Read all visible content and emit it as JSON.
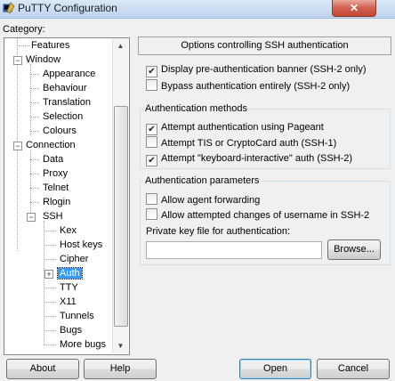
{
  "window": {
    "title": "PuTTY Configuration",
    "close_label": "✕",
    "icon": "putty-app-icon"
  },
  "category_label": "Category:",
  "tree": {
    "items": [
      {
        "label": "Features",
        "level": 2
      },
      {
        "label": "Window",
        "level": 1,
        "expanded": true
      },
      {
        "label": "Appearance",
        "level": 2
      },
      {
        "label": "Behaviour",
        "level": 2
      },
      {
        "label": "Translation",
        "level": 2
      },
      {
        "label": "Selection",
        "level": 2
      },
      {
        "label": "Colours",
        "level": 2
      },
      {
        "label": "Connection",
        "level": 1,
        "expanded": true
      },
      {
        "label": "Data",
        "level": 2
      },
      {
        "label": "Proxy",
        "level": 2
      },
      {
        "label": "Telnet",
        "level": 2
      },
      {
        "label": "Rlogin",
        "level": 2
      },
      {
        "label": "SSH",
        "level": 2,
        "expanded": true
      },
      {
        "label": "Kex",
        "level": 3
      },
      {
        "label": "Host keys",
        "level": 3
      },
      {
        "label": "Cipher",
        "level": 3
      },
      {
        "label": "Auth",
        "level": 3,
        "selected": true,
        "collapsed": true
      },
      {
        "label": "TTY",
        "level": 3
      },
      {
        "label": "X11",
        "level": 3
      },
      {
        "label": "Tunnels",
        "level": 3
      },
      {
        "label": "Bugs",
        "level": 3
      },
      {
        "label": "More bugs",
        "level": 3
      }
    ]
  },
  "panel": {
    "header": "Options controlling SSH authentication",
    "banner_options": [
      {
        "label": "Display pre-authentication banner (SSH-2 only)",
        "checked": true
      },
      {
        "label": "Bypass authentication entirely (SSH-2 only)",
        "checked": false
      }
    ],
    "methods": {
      "title": "Authentication methods",
      "options": [
        {
          "label": "Attempt authentication using Pageant",
          "checked": true
        },
        {
          "label": "Attempt TIS or CryptoCard auth (SSH-1)",
          "checked": false
        },
        {
          "label": "Attempt \"keyboard-interactive\" auth (SSH-2)",
          "checked": true
        }
      ]
    },
    "params": {
      "title": "Authentication parameters",
      "options": [
        {
          "label": "Allow agent forwarding",
          "checked": false
        },
        {
          "label": "Allow attempted changes of username in SSH-2",
          "checked": false
        }
      ],
      "keyfile_label": "Private key file for authentication:",
      "keyfile_value": "",
      "browse_label": "Browse..."
    }
  },
  "buttons": {
    "about": "About",
    "help": "Help",
    "open": "Open",
    "cancel": "Cancel"
  }
}
